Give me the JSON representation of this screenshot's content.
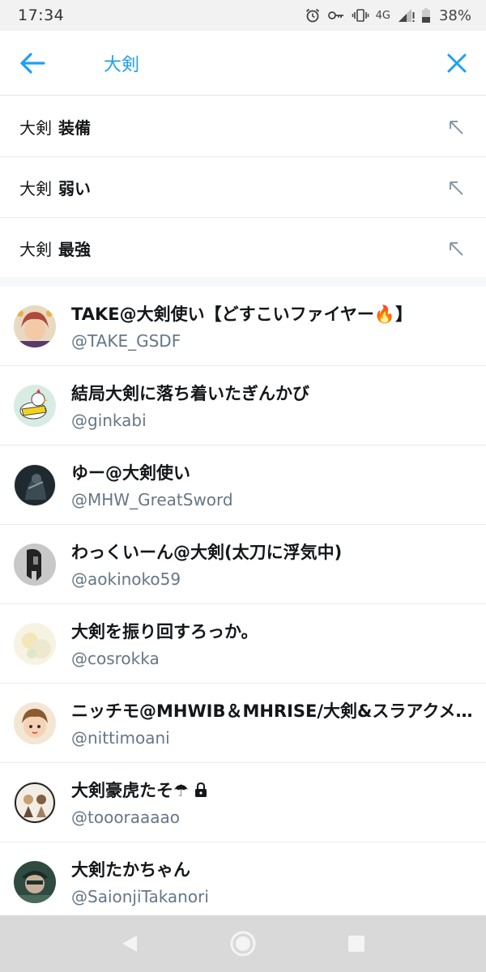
{
  "status_bar": {
    "time": "17:34",
    "network": "4G",
    "battery": "38%",
    "icons": [
      "alarm-icon",
      "key-icon",
      "vibrate-icon",
      "signal-icon",
      "battery-icon"
    ]
  },
  "search": {
    "query": "大剣",
    "back_icon": "arrow-left-icon",
    "clear_icon": "close-icon",
    "accent_color": "#1da1f2"
  },
  "suggestions": [
    {
      "query": "大剣",
      "completion": "装備"
    },
    {
      "query": "大剣",
      "completion": "弱い"
    },
    {
      "query": "大剣",
      "completion": "最強"
    }
  ],
  "users": [
    {
      "name": "TAKE@大剣使い【どすこいファイヤー🔥】",
      "handle": "@TAKE_GSDF",
      "protected": false
    },
    {
      "name": "結局大剣に落ち着いたぎんかび",
      "handle": "@ginkabi",
      "protected": false
    },
    {
      "name": "ゆー@大剣使い",
      "handle": "@MHW_GreatSword",
      "protected": false
    },
    {
      "name": "わっくいーん@大剣(太刀に浮気中)",
      "handle": "@aokinoko59",
      "protected": false
    },
    {
      "name": "大剣を振り回すろっか。",
      "handle": "@cosrokka",
      "protected": false
    },
    {
      "name": "ニッチモ@MHWIB＆MHRISE/大剣&スラアクメイン",
      "handle": "@nittimoani",
      "protected": false
    },
    {
      "name": "大剣豪虎たそ☂",
      "handle": "@toooraaaao",
      "protected": true
    },
    {
      "name": "大剣たかちゃん",
      "handle": "@SaionjiTakanori",
      "protected": false
    }
  ],
  "nav": {
    "icons": [
      "back-triangle-icon",
      "home-circle-icon",
      "recents-square-icon"
    ]
  }
}
